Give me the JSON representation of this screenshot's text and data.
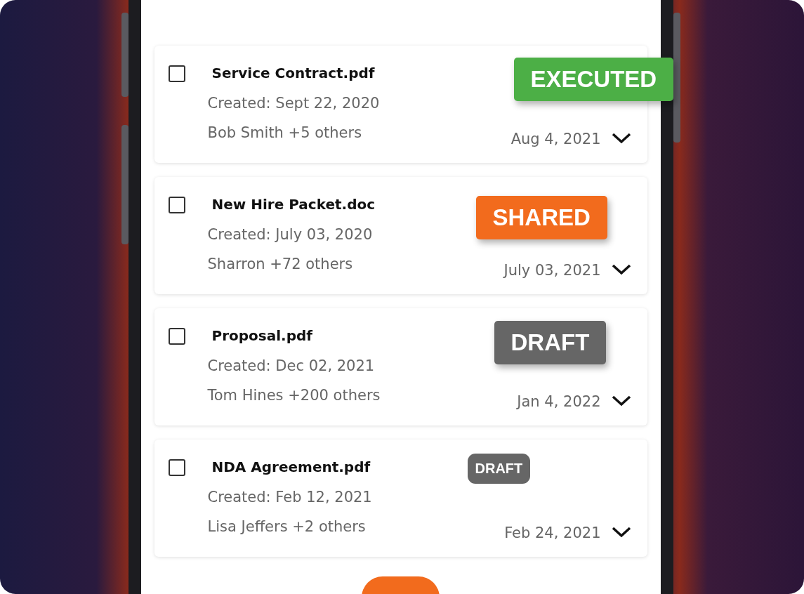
{
  "documents": [
    {
      "name": "Service Contract.pdf",
      "created": "Created: Sept 22, 2020",
      "people": "Bob Smith +5 others",
      "date": "Aug 4, 2021",
      "checked": false,
      "status": {
        "label": "EXECUTED",
        "kind": "callout",
        "color": "#4caf46"
      }
    },
    {
      "name": "New Hire Packet.doc",
      "created": "Created: July 03, 2020",
      "people": "Sharron +72 others",
      "date": "July 03, 2021",
      "checked": false,
      "status": {
        "label": "SHARED",
        "kind": "callout",
        "color": "#f26b1d"
      }
    },
    {
      "name": "Proposal.pdf",
      "created": "Created: Dec 02, 2021",
      "people": "Tom Hines +200 others",
      "date": "Jan 4, 2022",
      "checked": false,
      "status": {
        "label": "DRAFT",
        "kind": "callout",
        "color": "#666666"
      }
    },
    {
      "name": "NDA Agreement.pdf",
      "created": "Created: Feb 12, 2021",
      "people": "Lisa Jeffers +2 others",
      "date": "Feb 24, 2021",
      "checked": false,
      "status": {
        "label": "DRAFT",
        "kind": "tag",
        "color": "#666666"
      }
    }
  ]
}
